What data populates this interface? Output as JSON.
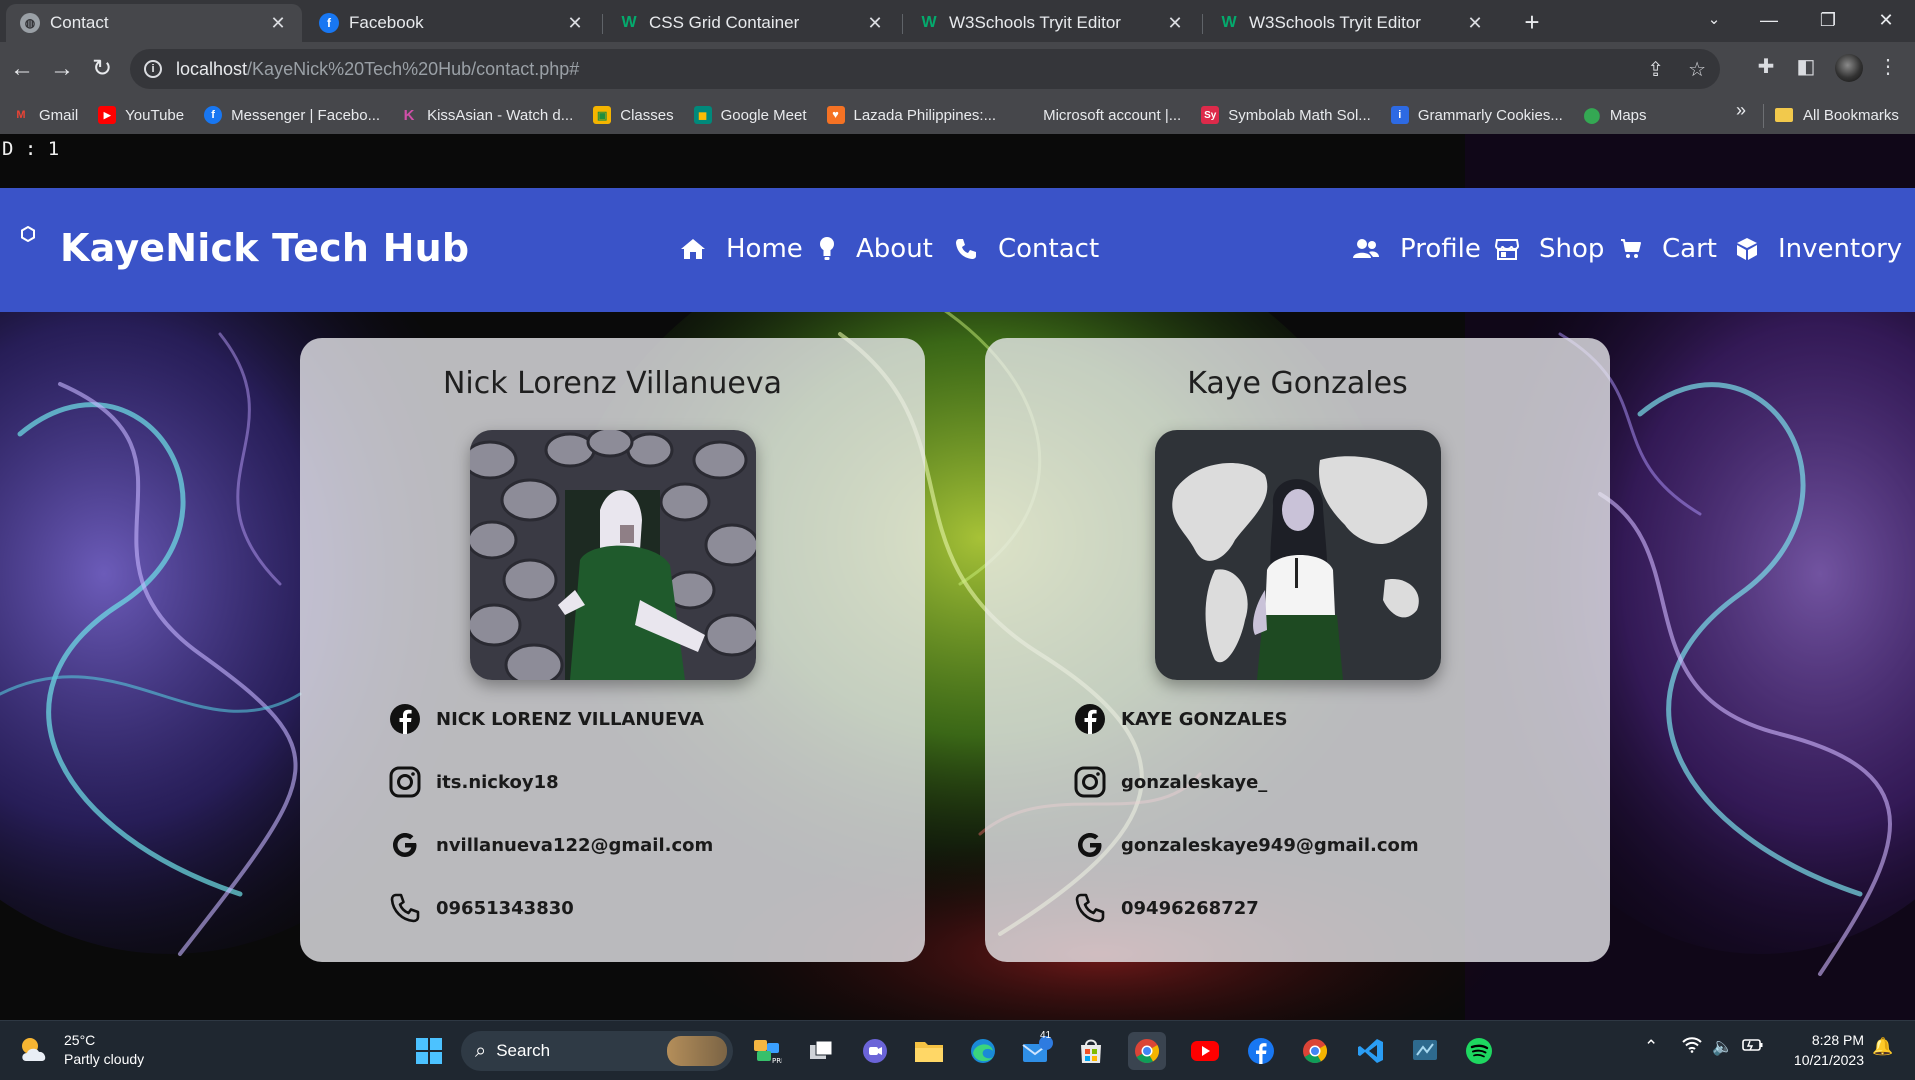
{
  "browser": {
    "tabs": [
      {
        "title": "Contact",
        "active": true,
        "icon": "globe-icon"
      },
      {
        "title": "Facebook",
        "active": false,
        "icon": "facebook-icon"
      },
      {
        "title": "CSS Grid Container",
        "active": false,
        "icon": "w3schools-icon"
      },
      {
        "title": "W3Schools Tryit Editor",
        "active": false,
        "icon": "w3schools-icon"
      },
      {
        "title": "W3Schools Tryit Editor",
        "active": false,
        "icon": "w3schools-icon"
      }
    ],
    "url_host": "localhost",
    "url_path": "/KayeNick%20Tech%20Hub/contact.php#",
    "bookmarks": [
      {
        "label": "Gmail",
        "icon": "gmail-icon",
        "color": "#ea4335"
      },
      {
        "label": "YouTube",
        "icon": "youtube-icon",
        "color": "#ff0000"
      },
      {
        "label": "Messenger | Facebo...",
        "icon": "facebook-icon",
        "color": "#1877f2"
      },
      {
        "label": "KissAsian - Watch d...",
        "icon": "kissasian-icon",
        "color": "#b34a9a"
      },
      {
        "label": "Classes",
        "icon": "classroom-icon",
        "color": "#f4b400"
      },
      {
        "label": "Google Meet",
        "icon": "meet-icon",
        "color": "#00897b"
      },
      {
        "label": "Lazada Philippines:...",
        "icon": "lazada-icon",
        "color": "#f57224"
      },
      {
        "label": "Microsoft account |...",
        "icon": "microsoft-icon",
        "color": "#7fba00"
      },
      {
        "label": "Symbolab Math Sol...",
        "icon": "symbolab-icon",
        "color": "#dd2a4a"
      },
      {
        "label": "Grammarly Cookies...",
        "icon": "grammarly-icon",
        "color": "#2d6ae3"
      },
      {
        "label": "Maps",
        "icon": "maps-icon",
        "color": "#34a853"
      }
    ],
    "all_bookmarks": "All Bookmarks",
    "more_bookmarks": "»"
  },
  "page": {
    "debug_text": "D : 1",
    "brand": "KayeNick Tech Hub",
    "nav_left": [
      {
        "label": "Home",
        "icon": "home-icon"
      },
      {
        "label": "About",
        "icon": "lightbulb-icon"
      },
      {
        "label": "Contact",
        "icon": "phone-icon"
      }
    ],
    "nav_right": [
      {
        "label": "Profile",
        "icon": "users-icon"
      },
      {
        "label": "Shop",
        "icon": "store-icon"
      },
      {
        "label": "Cart",
        "icon": "cart-icon"
      },
      {
        "label": "Inventory",
        "icon": "box-icon"
      }
    ],
    "colors": {
      "nav": "#3a53c8"
    },
    "contacts": [
      {
        "name": "Nick Lorenz Villanueva",
        "facebook": "NICK LORENZ VILLANUEVA",
        "instagram": "its.nickoy18",
        "email": "nvillanueva122@gmail.com",
        "phone": "09651343830"
      },
      {
        "name": "Kaye Gonzales",
        "facebook": "KAYE GONZALES",
        "instagram": "gonzaleskaye_",
        "email": "gonzaleskaye949@gmail.com",
        "phone": "09496268727"
      }
    ]
  },
  "taskbar": {
    "weather_temp": "25°C",
    "weather_desc": "Partly cloudy",
    "search_label": "Search",
    "mail_badge": "41",
    "time": "8:28 PM",
    "date": "10/21/2023"
  }
}
